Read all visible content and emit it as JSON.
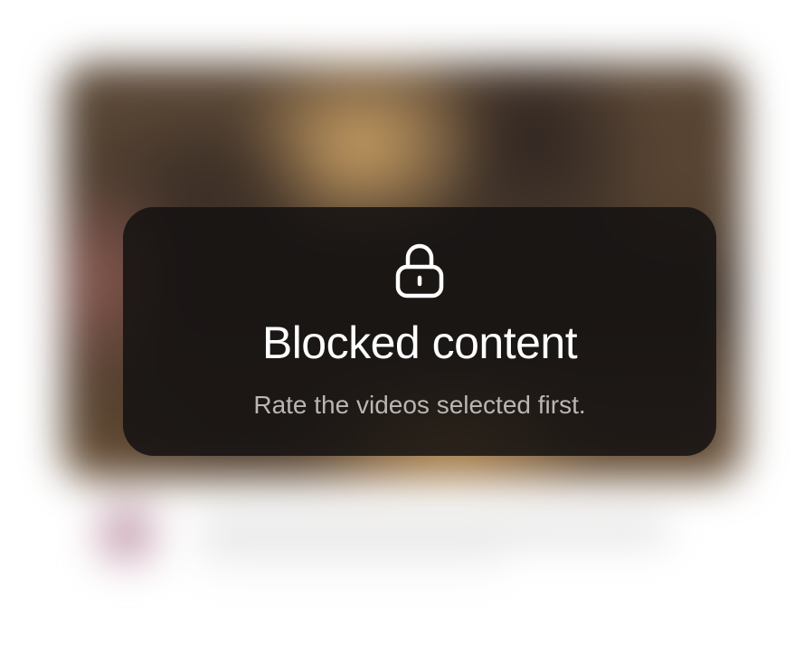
{
  "overlay": {
    "icon": "lock-icon",
    "title": "Blocked content",
    "message": "Rate the videos selected first."
  },
  "colors": {
    "overlay_background": "#141211",
    "title": "#ffffff",
    "message": "#b9b6b3"
  }
}
